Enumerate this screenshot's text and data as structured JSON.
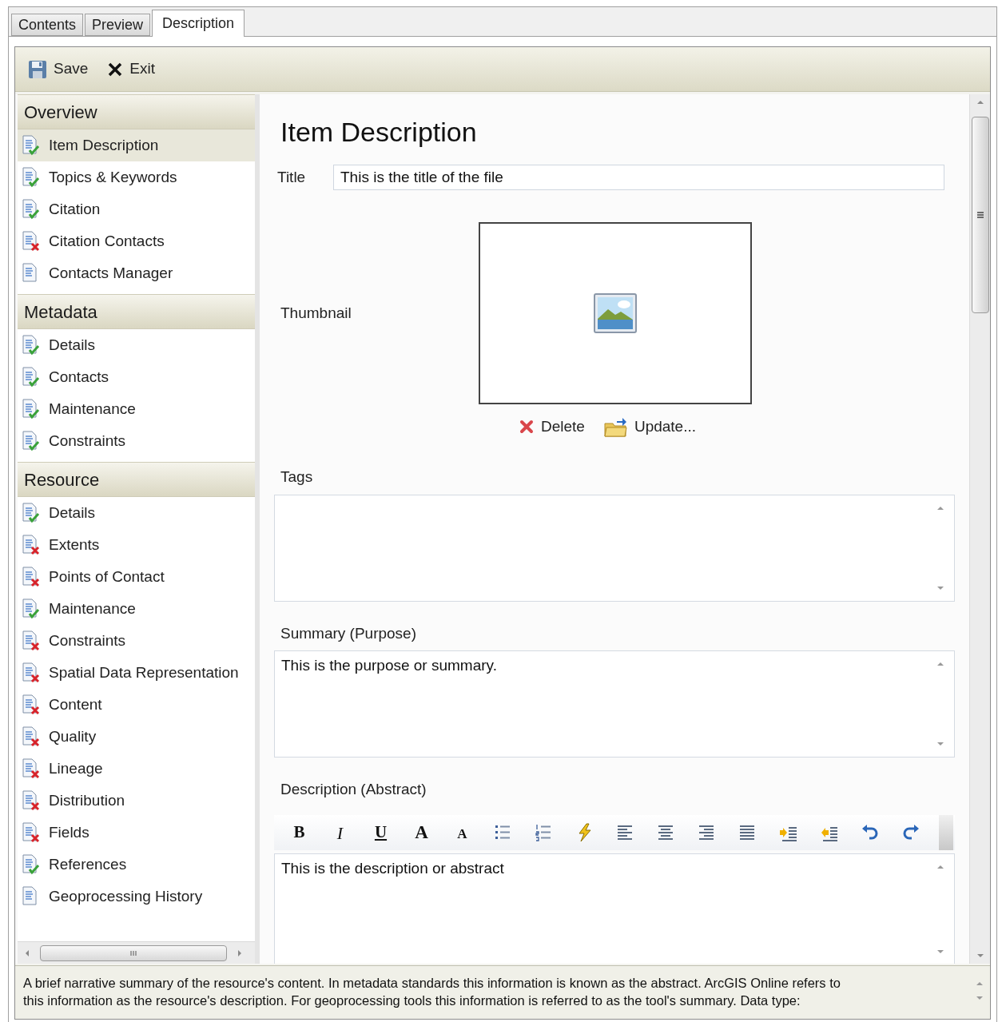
{
  "tabs": [
    {
      "label": "Contents",
      "selected": false
    },
    {
      "label": "Preview",
      "selected": false
    },
    {
      "label": "Description",
      "selected": true
    }
  ],
  "toolbar": [
    {
      "kind": "save",
      "label": "Save"
    },
    {
      "kind": "exit",
      "label": "Exit"
    }
  ],
  "sidebar": {
    "sections": [
      {
        "title": "Overview",
        "items": [
          {
            "label": "Item Description",
            "kind": "complete",
            "selected": true
          },
          {
            "label": "Topics & Keywords",
            "kind": "complete",
            "selected": false
          },
          {
            "label": "Citation",
            "kind": "complete",
            "selected": false
          },
          {
            "label": "Citation Contacts",
            "kind": "incomplete",
            "selected": false
          },
          {
            "label": "Contacts Manager",
            "kind": "plain",
            "selected": false
          }
        ]
      },
      {
        "title": "Metadata",
        "items": [
          {
            "label": "Details",
            "kind": "complete",
            "selected": false
          },
          {
            "label": "Contacts",
            "kind": "complete",
            "selected": false
          },
          {
            "label": "Maintenance",
            "kind": "complete",
            "selected": false
          },
          {
            "label": "Constraints",
            "kind": "complete",
            "selected": false
          }
        ]
      },
      {
        "title": "Resource",
        "items": [
          {
            "label": "Details",
            "kind": "complete",
            "selected": false
          },
          {
            "label": "Extents",
            "kind": "incomplete",
            "selected": false
          },
          {
            "label": "Points of Contact",
            "kind": "incomplete",
            "selected": false
          },
          {
            "label": "Maintenance",
            "kind": "complete",
            "selected": false
          },
          {
            "label": "Constraints",
            "kind": "incomplete",
            "selected": false
          },
          {
            "label": "Spatial Data Representation",
            "kind": "incomplete",
            "selected": false
          },
          {
            "label": "Content",
            "kind": "incomplete",
            "selected": false
          },
          {
            "label": "Quality",
            "kind": "incomplete",
            "selected": false
          },
          {
            "label": "Lineage",
            "kind": "incomplete",
            "selected": false
          },
          {
            "label": "Distribution",
            "kind": "incomplete",
            "selected": false
          },
          {
            "label": "Fields",
            "kind": "incomplete",
            "selected": false
          },
          {
            "label": "References",
            "kind": "complete",
            "selected": false
          },
          {
            "label": "Geoprocessing History",
            "kind": "plain",
            "selected": false
          }
        ]
      }
    ]
  },
  "content": {
    "heading": "Item Description",
    "title_field": {
      "label": "Title",
      "value": "This is the title of the file"
    },
    "thumbnail": {
      "label": "Thumbnail",
      "actions": [
        {
          "kind": "delete",
          "label": "Delete"
        },
        {
          "kind": "update",
          "label": "Update..."
        }
      ]
    },
    "tags": {
      "label": "Tags"
    },
    "summary": {
      "label": "Summary (Purpose)",
      "value": "This is the purpose or summary."
    },
    "description": {
      "label": "Description (Abstract)",
      "value": "This is the description or abstract",
      "toolbar": [
        {
          "kind": "bold",
          "label": "B"
        },
        {
          "kind": "italic",
          "label": "I"
        },
        {
          "kind": "underline",
          "label": "U"
        },
        {
          "kind": "grow",
          "label": "A"
        },
        {
          "kind": "shrink",
          "label": "A"
        },
        {
          "kind": "bullets"
        },
        {
          "kind": "numbers"
        },
        {
          "kind": "lightning"
        },
        {
          "kind": "align-left"
        },
        {
          "kind": "align-center"
        },
        {
          "kind": "align-right"
        },
        {
          "kind": "justify"
        },
        {
          "kind": "indent"
        },
        {
          "kind": "outdent"
        },
        {
          "kind": "undo"
        },
        {
          "kind": "redo"
        }
      ]
    }
  },
  "help_text": "A brief narrative summary of the resource's content. In metadata standards this information is known as the abstract. ArcGIS Online refers to this information as the resource's description. For geoprocessing tools this information is referred to as the tool's summary. Data type:"
}
